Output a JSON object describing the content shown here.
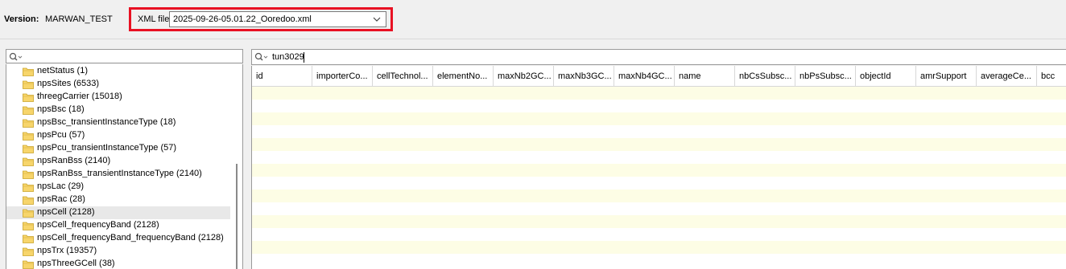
{
  "topbar": {
    "version_label": "Version:",
    "version_value": "MARWAN_TEST",
    "xml_label": "XML file",
    "xml_selected": "2025-09-26-05.01.22_Ooredoo.xml",
    "highlight_color": "#e81123"
  },
  "tree_search": {
    "value": ""
  },
  "tree": {
    "items": [
      {
        "label": "netStatus (1)",
        "selected": false
      },
      {
        "label": "npsSites (6533)",
        "selected": false
      },
      {
        "label": "threegCarrier (15018)",
        "selected": false
      },
      {
        "label": "npsBsc (18)",
        "selected": false
      },
      {
        "label": "npsBsc_transientInstanceType (18)",
        "selected": false
      },
      {
        "label": "npsPcu (57)",
        "selected": false
      },
      {
        "label": "npsPcu_transientInstanceType (57)",
        "selected": false
      },
      {
        "label": "npsRanBss (2140)",
        "selected": false
      },
      {
        "label": "npsRanBss_transientInstanceType (2140)",
        "selected": false
      },
      {
        "label": "npsLac (29)",
        "selected": false
      },
      {
        "label": "npsRac (28)",
        "selected": false
      },
      {
        "label": "npsCell (2128)",
        "selected": true
      },
      {
        "label": "npsCell_frequencyBand (2128)",
        "selected": false
      },
      {
        "label": "npsCell_frequencyBand_frequencyBand (2128)",
        "selected": false
      },
      {
        "label": "npsTrx (19357)",
        "selected": false
      },
      {
        "label": "npsThreeGCell (38)",
        "selected": false
      }
    ]
  },
  "table_search": {
    "value": "tun3029"
  },
  "table": {
    "columns": [
      "id",
      "importerCo...",
      "cellTechnol...",
      "elementNo...",
      "maxNb2GC...",
      "maxNb3GC...",
      "maxNb4GC...",
      "name",
      "nbCsSubsc...",
      "nbPsSubsc...",
      "objectId",
      "amrSupport",
      "averageCe...",
      "bcc"
    ],
    "row_color": "#fdfde5"
  }
}
